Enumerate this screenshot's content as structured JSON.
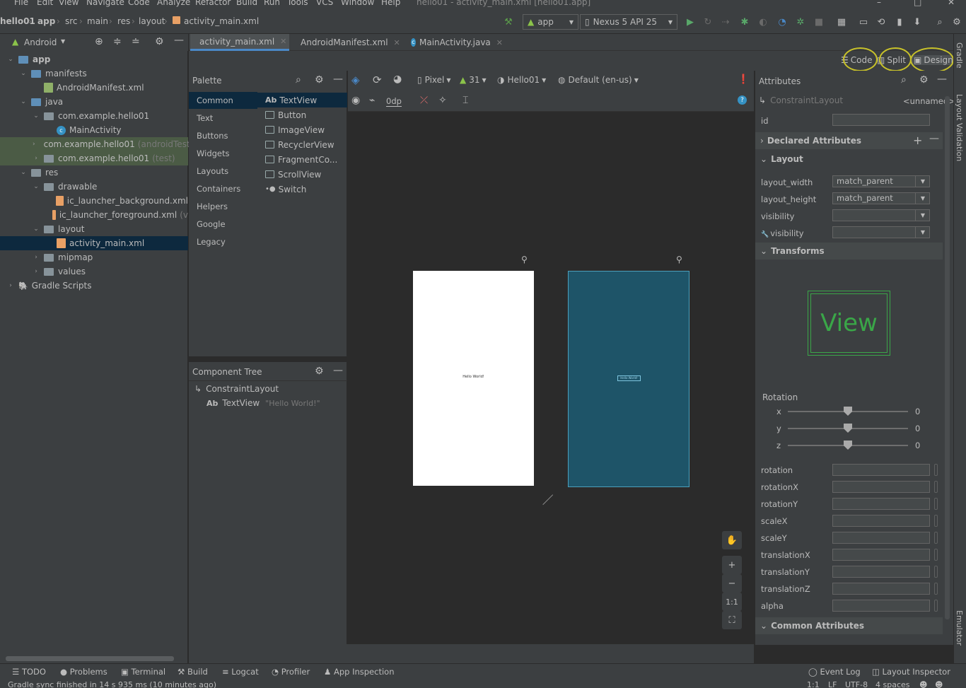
{
  "menu": [
    "File",
    "Edit",
    "View",
    "Navigate",
    "Code",
    "Analyze",
    "Refactor",
    "Build",
    "Run",
    "Tools",
    "VCS",
    "Window",
    "Help"
  ],
  "window_title": "hello01 - activity_main.xml [hello01.app]",
  "breadcrumb": [
    "hello01",
    "app",
    "src",
    "main",
    "res",
    "layout",
    "activity_main.xml"
  ],
  "toolbar": {
    "run_config": "app",
    "device": "Nexus 5 API 25"
  },
  "project": {
    "view_mode": "Android",
    "tree": [
      {
        "label": "app",
        "indent": 0,
        "type": "module",
        "arrow": "down"
      },
      {
        "label": "manifests",
        "indent": 1,
        "type": "folder-blue",
        "arrow": "down"
      },
      {
        "label": "AndroidManifest.xml",
        "indent": 2,
        "type": "manifest",
        "arrow": ""
      },
      {
        "label": "java",
        "indent": 1,
        "type": "folder-blue",
        "arrow": "down"
      },
      {
        "label": "com.example.hello01",
        "indent": 2,
        "type": "folder",
        "arrow": "down"
      },
      {
        "label": "MainActivity",
        "indent": 3,
        "type": "class",
        "arrow": ""
      },
      {
        "label": "com.example.hello01",
        "suffix": "(androidTest)",
        "indent": 2,
        "type": "folder",
        "arrow": "right",
        "hl": true
      },
      {
        "label": "com.example.hello01",
        "suffix": "(test)",
        "indent": 2,
        "type": "folder",
        "arrow": "right",
        "hl": true
      },
      {
        "label": "res",
        "indent": 1,
        "type": "folder-res",
        "arrow": "down"
      },
      {
        "label": "drawable",
        "indent": 2,
        "type": "folder",
        "arrow": "down"
      },
      {
        "label": "ic_launcher_background.xml",
        "indent": 3,
        "type": "xml",
        "arrow": ""
      },
      {
        "label": "ic_launcher_foreground.xml",
        "suffix": "(v",
        "indent": 3,
        "type": "xml",
        "arrow": ""
      },
      {
        "label": "layout",
        "indent": 2,
        "type": "folder",
        "arrow": "down"
      },
      {
        "label": "activity_main.xml",
        "indent": 3,
        "type": "xml",
        "arrow": "",
        "sel": true
      },
      {
        "label": "mipmap",
        "indent": 2,
        "type": "folder",
        "arrow": "right"
      },
      {
        "label": "values",
        "indent": 2,
        "type": "folder",
        "arrow": "right"
      },
      {
        "label": "Gradle Scripts",
        "indent": 0,
        "type": "gradle",
        "arrow": "right"
      }
    ]
  },
  "tabs": [
    {
      "label": "activity_main.xml",
      "active": true
    },
    {
      "label": "AndroidManifest.xml",
      "active": false
    },
    {
      "label": "MainActivity.java",
      "active": false
    }
  ],
  "modes": {
    "code": "Code",
    "split": "Split",
    "design": "Design"
  },
  "palette": {
    "title": "Palette",
    "categories": [
      "Common",
      "Text",
      "Buttons",
      "Widgets",
      "Layouts",
      "Containers",
      "Helpers",
      "Google",
      "Legacy"
    ],
    "items": [
      "TextView",
      "Button",
      "ImageView",
      "RecyclerView",
      "FragmentCo...",
      "ScrollView",
      "Switch"
    ],
    "textview_prefix": "Ab"
  },
  "component_tree": {
    "title": "Component Tree",
    "root": "ConstraintLayout",
    "child_prefix": "Ab",
    "child": "TextView",
    "child_text": "\"Hello World!\""
  },
  "design_toolbar": {
    "device": "Pixel",
    "api": "31",
    "theme": "Hello01",
    "locale": "Default (en-us)",
    "margin": "0dp"
  },
  "preview": {
    "text": "Hello World!",
    "zoom_fit": "1:1"
  },
  "attributes": {
    "title": "Attributes",
    "component": "ConstraintLayout",
    "component_id": "<unnamed>",
    "id_label": "id",
    "sections": {
      "declared": "Declared Attributes",
      "layout": "Layout",
      "transforms": "Transforms",
      "common": "Common Attributes"
    },
    "layout_rows": [
      {
        "label": "layout_width",
        "value": "match_parent"
      },
      {
        "label": "layout_height",
        "value": "match_parent"
      },
      {
        "label": "visibility",
        "value": ""
      },
      {
        "label": "visibility",
        "value": ""
      }
    ],
    "view_preview": "View",
    "rotation_label": "Rotation",
    "rotation": [
      {
        "axis": "x",
        "value": "0"
      },
      {
        "axis": "y",
        "value": "0"
      },
      {
        "axis": "z",
        "value": "0"
      }
    ],
    "transform_rows": [
      "rotation",
      "rotationX",
      "rotationY",
      "scaleX",
      "scaleY",
      "translationX",
      "translationY",
      "translationZ",
      "alpha"
    ]
  },
  "right_strip": [
    "Gradle",
    "Layout Validation",
    "Emulator"
  ],
  "bottom_tools": [
    "TODO",
    "Problems",
    "Terminal",
    "Build",
    "Logcat",
    "Profiler",
    "App Inspection",
    "Event Log",
    "Layout Inspector"
  ],
  "status": {
    "message": "Gradle sync finished in 14 s 935 ms (10 minutes ago)",
    "position": "1:1",
    "line_sep": "LF",
    "encoding": "UTF-8",
    "indent": "4 spaces"
  },
  "colors": {
    "accent": "#4a88c7",
    "selection": "#0d293e",
    "blueprint": "#1e5468",
    "highlight": "#c8c22a"
  }
}
